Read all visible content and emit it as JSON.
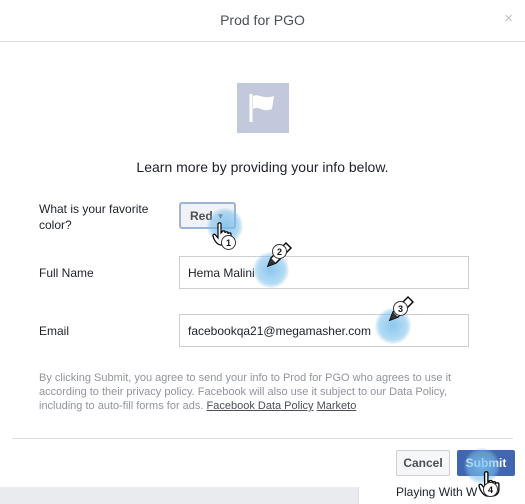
{
  "dialog": {
    "title": "Prod for PGO",
    "close_glyph": "×",
    "intro": "Learn more by providing your info below."
  },
  "form": {
    "color_label": "What is your favorite color?",
    "color_value": "Red",
    "name_label": "Full Name",
    "name_value": "Hema Malini",
    "email_label": "Email",
    "email_value": "facebookqa21@megamasher.com"
  },
  "disclaimer": {
    "text": "By clicking Submit, you agree to send your info to Prod for PGO who agrees to use it according to their privacy policy. Facebook will also use it subject to our Data Policy, including to auto-fill forms for ads.",
    "link_policy": "Facebook Data Policy",
    "link_marketo": "Marketo"
  },
  "footer": {
    "cancel_label": "Cancel",
    "submit_label": "Submit"
  },
  "background": {
    "partial_text": "Playing With W"
  },
  "annotations": {
    "step1": "1",
    "step2": "2",
    "step3": "3",
    "step4": "4"
  },
  "colors": {
    "submit_bg": "#4267b2",
    "flag_bg": "#c3c9dc",
    "marker": "#78bee b"
  },
  "icons": [
    "flag-icon",
    "close-icon",
    "caret-down-icon",
    "hand-cursor-icon",
    "pencil-icon"
  ]
}
